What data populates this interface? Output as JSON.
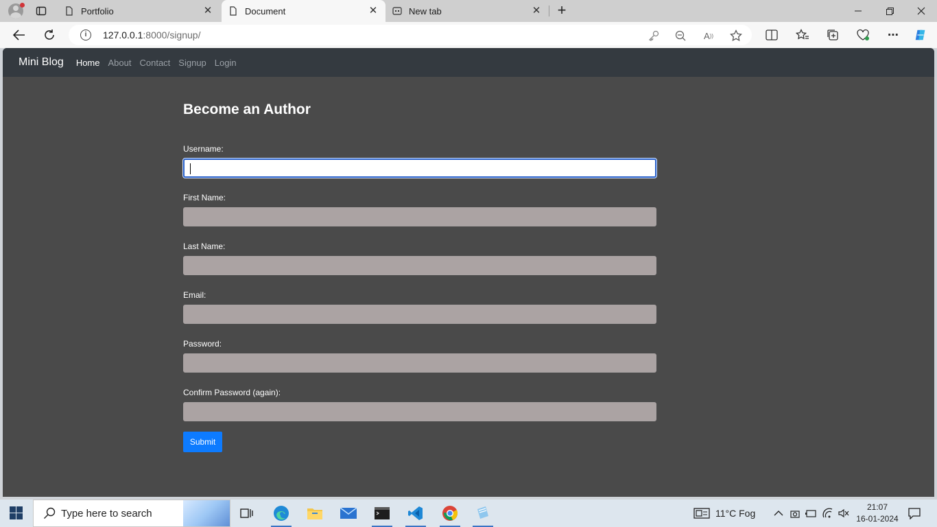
{
  "browser": {
    "tabs": [
      {
        "label": "Portfolio"
      },
      {
        "label": "Document"
      },
      {
        "label": "New tab"
      }
    ],
    "address": {
      "host": "127.0.0.1",
      "rest": ":8000/signup/"
    }
  },
  "site": {
    "brand": "Mini Blog",
    "nav": [
      "Home",
      "About",
      "Contact",
      "Signup",
      "Login"
    ]
  },
  "form": {
    "title": "Become an Author",
    "fields": [
      {
        "label": "Username:",
        "value": ""
      },
      {
        "label": "First Name:",
        "value": ""
      },
      {
        "label": "Last Name:",
        "value": ""
      },
      {
        "label": "Email:",
        "value": ""
      },
      {
        "label": "Password:",
        "value": ""
      },
      {
        "label": "Confirm Password (again):",
        "value": ""
      }
    ],
    "submit_label": "Submit"
  },
  "taskbar": {
    "search_placeholder": "Type here to search",
    "weather": "11°C  Fog",
    "time": "21:07",
    "date": "16-01-2024"
  }
}
